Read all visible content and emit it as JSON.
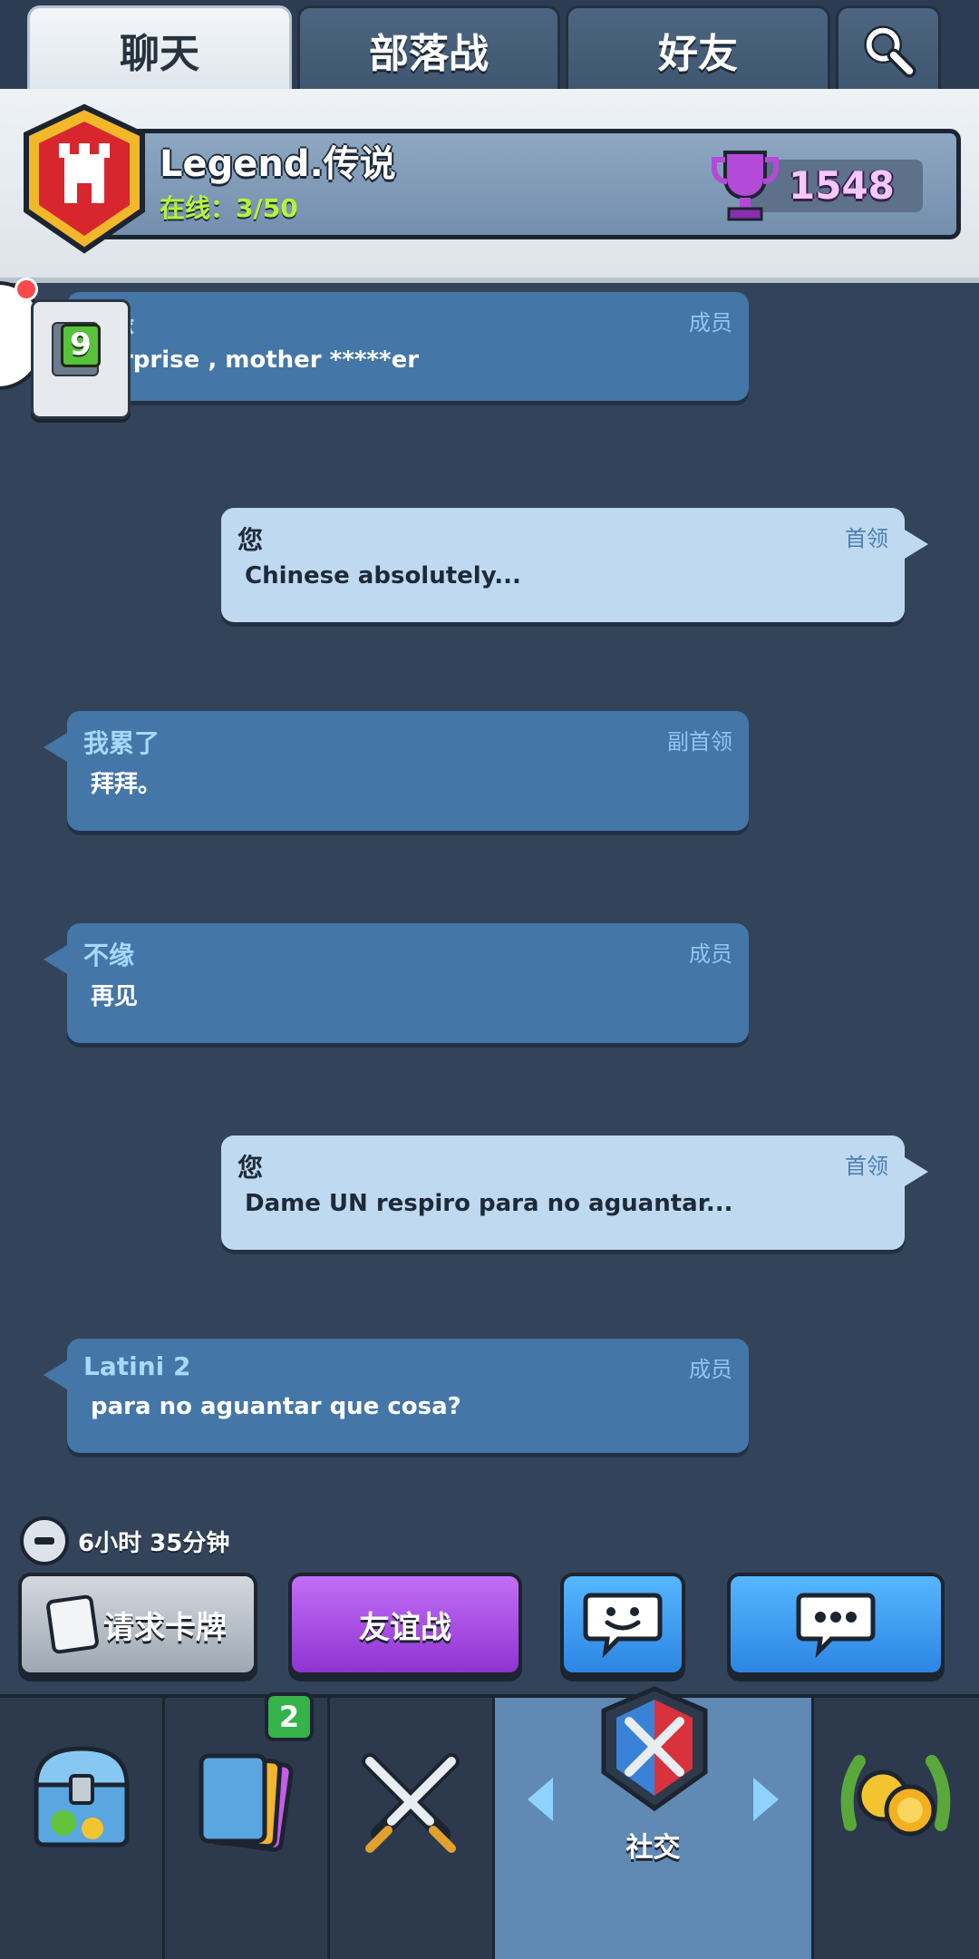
{
  "tabs": [
    {
      "label": "聊天",
      "active": true
    },
    {
      "label": "部落战",
      "active": false
    },
    {
      "label": "好友",
      "active": false
    }
  ],
  "clan": {
    "name": "Legend.传说",
    "online_label": "在线：3/50",
    "trophies": "1548"
  },
  "side_card": {
    "level": "9"
  },
  "messages": [
    {
      "sender": "不缘",
      "role": "成员",
      "text": "surprise , mother *****er",
      "type": "other"
    },
    {
      "sender": "您",
      "role": "首领",
      "text": "Chinese absolutely...",
      "type": "self"
    },
    {
      "sender": "我累了",
      "role": "副首领",
      "text": "拜拜。",
      "type": "other"
    },
    {
      "sender": "不缘",
      "role": "成员",
      "text": "再见",
      "type": "other"
    },
    {
      "sender": "您",
      "role": "首领",
      "text": "Dame UN respiro para no aguantar...",
      "type": "self"
    },
    {
      "sender": "Latini 2",
      "role": "成员",
      "text": "para no aguantar que cosa?",
      "type": "other"
    }
  ],
  "timer": {
    "text": "6小时 35分钟"
  },
  "actions": {
    "request_cards": "请求卡牌",
    "friendly_battle": "友谊战"
  },
  "nav": {
    "social_label": "社交",
    "cards_badge": "2"
  },
  "colors": {
    "background": "#33445a",
    "other_bubble": "#4476a7",
    "self_bubble": "#bfd9f1",
    "online_green": "#b8f23c",
    "trophy_purple": "#f4c7ff",
    "friendly_purple": "#a652e6",
    "chat_blue": "#3d9cf0"
  }
}
